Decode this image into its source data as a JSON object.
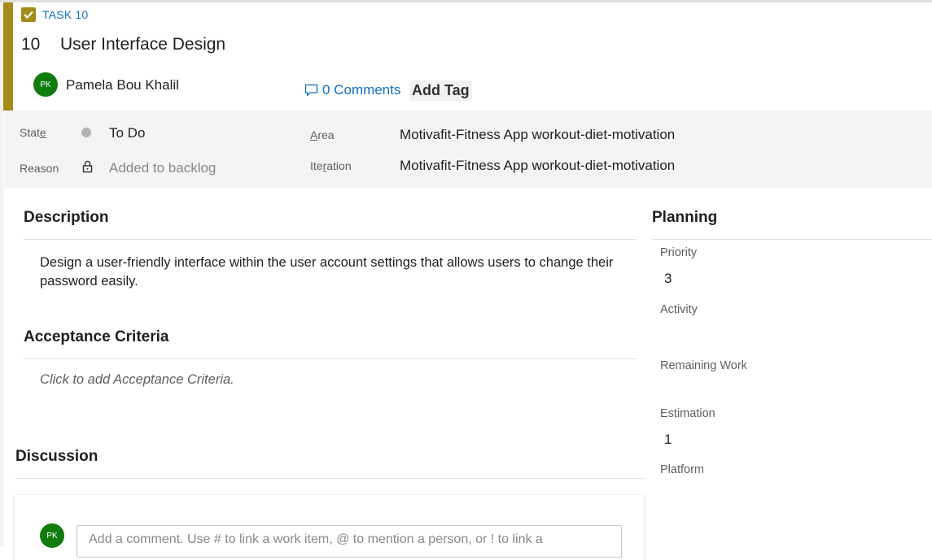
{
  "work_item": {
    "type_label": "TASK 10",
    "id": "10",
    "title": "User Interface Design",
    "assignee": {
      "initials": "PK",
      "name": "Pamela Bou Khalil"
    },
    "comments_label": "0 Comments",
    "add_tag_label": "Add Tag",
    "accent_color": "#a38c18"
  },
  "fields": {
    "state": {
      "label_pre": "Stat",
      "label_u": "e",
      "label_post": "",
      "value": "To Do",
      "status_color": "#b2b2b2"
    },
    "reason": {
      "label": "Reason",
      "value": "Added to backlog"
    },
    "area": {
      "label_pre": "",
      "label_u": "A",
      "label_post": "rea",
      "value": "Motivafit-Fitness App workout-diet-motivation"
    },
    "iteration": {
      "label_pre": "Ite",
      "label_u": "r",
      "label_post": "ation",
      "value": "Motivafit-Fitness App workout-diet-motivation"
    }
  },
  "description": {
    "title": "Description",
    "text": "Design a user-friendly interface within the user account settings that allows users to change their password easily."
  },
  "acceptance": {
    "title": "Acceptance Criteria",
    "placeholder": "Click to add Acceptance Criteria."
  },
  "discussion": {
    "title": "Discussion",
    "avatar_initials": "PK",
    "comment_placeholder": "Add a comment. Use # to link a work item, @ to mention a person, or ! to link a"
  },
  "planning": {
    "title": "Planning",
    "priority": {
      "label": "Priority",
      "value": "3"
    },
    "activity": {
      "label": "Activity",
      "value": ""
    },
    "remaining_work": {
      "label": "Remaining Work",
      "value": ""
    },
    "estimation": {
      "label": "Estimation",
      "value": "1"
    },
    "platform": {
      "label": "Platform",
      "value": ""
    }
  },
  "icons": {
    "type": "checkbox-check-icon",
    "comments": "speech-bubble-icon",
    "state": "status-dot-icon",
    "reason": "lock-icon"
  }
}
